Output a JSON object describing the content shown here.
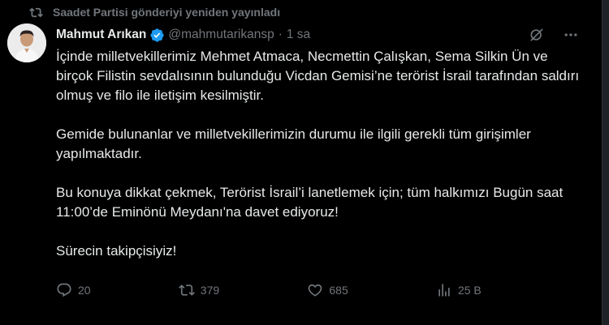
{
  "repost": {
    "text": "Saadet Partisi gönderiyi yeniden yayınladı"
  },
  "tweet": {
    "author": "Mahmut Arıkan",
    "handle": "@mahmutarikansp",
    "separator": "·",
    "time": "1 sa",
    "paragraphs": [
      "İçinde milletvekillerimiz Mehmet Atmaca, Necmettin Çalışkan, Sema Silkin Ün ve birçok Filistin sevdalısının bulunduğu Vicdan Gemisi’ne terörist İsrail tarafından saldırı olmuş ve filo ile iletişim kesilmiştir.",
      "Gemide bulunanlar ve milletvekillerimizin durumu ile ilgili gerekli tüm girişimler yapılmaktadır.",
      "Bu konuya dikkat çekmek, Terörist İsrail’i lanetlemek için; tüm halkımızı Bugün saat 11:00’de Eminönü Meydanı'na davet ediyoruz!",
      "Sürecin takipçisiyiz!"
    ]
  },
  "actions": {
    "replies": "20",
    "reposts": "379",
    "likes": "685",
    "views": "25 B"
  },
  "icons": {
    "repost": "repost-icon",
    "verified": "verified-badge-icon",
    "grok": "grok-icon",
    "more": "more-icon",
    "reply": "reply-icon",
    "like": "heart-icon",
    "views": "views-icon",
    "bookmark": "bookmark-icon",
    "share": "share-icon"
  },
  "colors": {
    "background": "#000000",
    "text": "#e7e9ea",
    "muted": "#71767b",
    "verified": "#1d9bf0"
  }
}
